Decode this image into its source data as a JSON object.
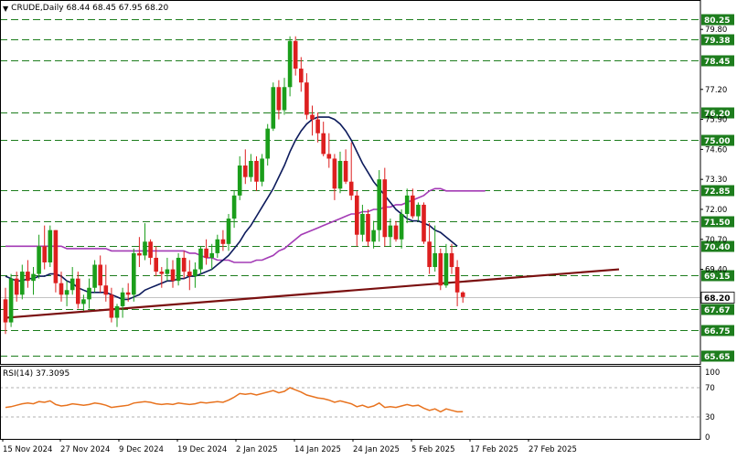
{
  "header": {
    "symbol": "CRUDE,Daily",
    "ohlc": "68.44 68.45 67.95 68.20",
    "dropdown_icon": "triangle-down-icon"
  },
  "rsi_header": {
    "label": "RSI(14) 37.3095"
  },
  "colors": {
    "bull": "#1b9e1b",
    "bear": "#dd1f1f",
    "ma_fast": "#0d1b5c",
    "ma_slow": "#a33bb5",
    "trendline": "#7a1010",
    "rsi": "#e8731f",
    "level_line": "#1d7d1d"
  },
  "chart_data": [
    {
      "type": "candlestick",
      "title": "CRUDE,Daily",
      "ylim": [
        65.3,
        80.6
      ],
      "y_ticks": [
        "79.80",
        "78.45",
        "77.20",
        "76.20",
        "75.90",
        "75.00",
        "74.60",
        "73.30",
        "72.85",
        "72.00",
        "71.50",
        "70.70",
        "70.40",
        "69.40",
        "69.15",
        "68.20",
        "67.67",
        "66.75",
        "65.65"
      ],
      "level_labels": [
        "80.25",
        "79.38",
        "78.45",
        "76.20",
        "75.00",
        "72.85",
        "71.50",
        "70.40",
        "69.15",
        "67.67",
        "66.75",
        "65.65"
      ],
      "current_price": "68.20",
      "x_labels": [
        "15 Nov 2024",
        "27 Nov 2024",
        "9 Dec 2024",
        "19 Dec 2024",
        "2 Jan 2025",
        "14 Jan 2025",
        "24 Jan 2025",
        "5 Feb 2025",
        "17 Feb 2025",
        "27 Feb 2025"
      ],
      "candles": [
        [
          68.1,
          68.6,
          66.6,
          67.1
        ],
        [
          67.1,
          69.2,
          66.9,
          69.0
        ],
        [
          69.0,
          69.3,
          68.0,
          68.3
        ],
        [
          68.3,
          69.6,
          68.1,
          69.3
        ],
        [
          69.3,
          69.8,
          68.6,
          68.9
        ],
        [
          68.9,
          69.5,
          68.3,
          69.2
        ],
        [
          69.2,
          70.9,
          69.0,
          70.4
        ],
        [
          70.4,
          71.3,
          69.4,
          69.7
        ],
        [
          69.7,
          71.3,
          69.5,
          71.1
        ],
        [
          71.1,
          71.1,
          68.4,
          68.8
        ],
        [
          68.8,
          69.3,
          68.0,
          68.3
        ],
        [
          68.3,
          68.9,
          67.8,
          68.5
        ],
        [
          68.5,
          69.5,
          68.3,
          69.0
        ],
        [
          69.0,
          69.3,
          67.7,
          67.9
        ],
        [
          67.9,
          68.3,
          67.6,
          68.1
        ],
        [
          68.1,
          69.0,
          67.7,
          68.6
        ],
        [
          68.6,
          69.8,
          68.4,
          69.6
        ],
        [
          69.6,
          70.0,
          68.4,
          68.7
        ],
        [
          68.7,
          69.6,
          68.0,
          68.3
        ],
        [
          68.3,
          68.6,
          67.1,
          67.3
        ],
        [
          67.3,
          67.9,
          66.9,
          67.8
        ],
        [
          67.8,
          68.6,
          67.3,
          68.4
        ],
        [
          68.4,
          68.8,
          68.0,
          68.3
        ],
        [
          68.3,
          70.3,
          68.0,
          70.1
        ],
        [
          70.1,
          70.8,
          69.5,
          70.0
        ],
        [
          70.0,
          71.4,
          69.8,
          70.6
        ],
        [
          70.6,
          70.7,
          69.6,
          69.9
        ],
        [
          69.9,
          70.4,
          69.1,
          69.3
        ],
        [
          69.3,
          69.5,
          68.6,
          69.2
        ],
        [
          69.2,
          69.9,
          68.9,
          69.4
        ],
        [
          69.4,
          69.8,
          68.6,
          68.9
        ],
        [
          68.9,
          70.1,
          68.7,
          69.9
        ],
        [
          69.9,
          70.2,
          69.0,
          69.3
        ],
        [
          69.3,
          69.8,
          68.5,
          69.1
        ],
        [
          69.1,
          69.7,
          68.6,
          69.4
        ],
        [
          69.4,
          70.4,
          69.2,
          70.3
        ],
        [
          70.3,
          70.7,
          69.6,
          69.9
        ],
        [
          69.9,
          70.5,
          69.4,
          70.1
        ],
        [
          70.1,
          70.9,
          69.9,
          70.7
        ],
        [
          70.7,
          71.1,
          70.2,
          70.5
        ],
        [
          70.5,
          71.8,
          70.2,
          71.6
        ],
        [
          71.6,
          72.8,
          71.2,
          72.6
        ],
        [
          72.6,
          74.3,
          72.4,
          73.9
        ],
        [
          73.9,
          74.6,
          73.1,
          73.4
        ],
        [
          73.4,
          74.4,
          73.2,
          74.1
        ],
        [
          74.1,
          74.3,
          72.8,
          73.2
        ],
        [
          73.2,
          74.4,
          73.0,
          74.2
        ],
        [
          74.2,
          75.7,
          73.9,
          75.5
        ],
        [
          75.5,
          77.5,
          75.4,
          77.3
        ],
        [
          77.3,
          77.6,
          75.9,
          76.3
        ],
        [
          76.3,
          77.7,
          76.1,
          77.3
        ],
        [
          77.3,
          79.5,
          76.9,
          79.3
        ],
        [
          79.3,
          79.5,
          77.8,
          78.1
        ],
        [
          78.1,
          78.6,
          77.1,
          77.5
        ],
        [
          77.5,
          77.9,
          75.9,
          76.1
        ],
        [
          76.1,
          76.5,
          75.2,
          75.9
        ],
        [
          75.9,
          76.2,
          74.9,
          75.3
        ],
        [
          75.3,
          75.8,
          74.3,
          74.4
        ],
        [
          74.4,
          75.3,
          73.8,
          74.2
        ],
        [
          74.2,
          74.4,
          72.4,
          72.9
        ],
        [
          72.9,
          74.5,
          72.7,
          74.1
        ],
        [
          74.1,
          74.6,
          73.1,
          73.2
        ],
        [
          73.2,
          74.9,
          72.4,
          72.6
        ],
        [
          72.6,
          72.8,
          70.4,
          70.9
        ],
        [
          70.9,
          72.2,
          70.6,
          71.8
        ],
        [
          71.8,
          72.0,
          70.4,
          70.6
        ],
        [
          70.6,
          71.5,
          70.3,
          71.1
        ],
        [
          71.1,
          73.7,
          70.6,
          73.3
        ],
        [
          73.3,
          73.8,
          70.4,
          70.8
        ],
        [
          70.8,
          71.6,
          70.4,
          71.3
        ],
        [
          71.3,
          71.5,
          70.6,
          70.7
        ],
        [
          70.7,
          72.0,
          70.3,
          71.8
        ],
        [
          71.8,
          72.9,
          71.4,
          72.6
        ],
        [
          72.6,
          72.9,
          71.6,
          71.7
        ],
        [
          71.7,
          72.3,
          71.5,
          72.2
        ],
        [
          72.2,
          72.3,
          70.5,
          70.6
        ],
        [
          70.6,
          71.4,
          69.2,
          69.5
        ],
        [
          69.5,
          71.3,
          69.3,
          70.1
        ],
        [
          70.1,
          70.3,
          68.5,
          68.7
        ],
        [
          68.7,
          70.5,
          68.6,
          70.1
        ],
        [
          70.1,
          70.5,
          69.2,
          69.5
        ],
        [
          69.5,
          69.8,
          67.8,
          68.4
        ],
        [
          68.4,
          68.45,
          67.95,
          68.2
        ]
      ],
      "series": [
        {
          "type": "line",
          "values": [
            69.1,
            69.0,
            68.9,
            68.9,
            69.0,
            69.0,
            69.1,
            69.1,
            69.2,
            69.2,
            69.1,
            68.9,
            68.8,
            68.6,
            68.5,
            68.4,
            68.4,
            68.4,
            68.4,
            68.3,
            68.2,
            68.1,
            68.1,
            68.2,
            68.3,
            68.5,
            68.6,
            68.7,
            68.8,
            68.9,
            68.9,
            69.0,
            69.0,
            69.1,
            69.1,
            69.2,
            69.3,
            69.4,
            69.6,
            69.8,
            70.0,
            70.3,
            70.6,
            71.0,
            71.3,
            71.7,
            72.1,
            72.5,
            72.9,
            73.4,
            73.9,
            74.5,
            75.0,
            75.4,
            75.7,
            75.9,
            76.0,
            76.0,
            76.0,
            75.9,
            75.7,
            75.4,
            75.0,
            74.5,
            74.0,
            73.6,
            73.2,
            72.9,
            72.6,
            72.3,
            72.0,
            71.8,
            71.6,
            71.5,
            71.5,
            71.4,
            71.3,
            71.1,
            71.0,
            70.8,
            70.6,
            70.4
          ]
        },
        {
          "type": "line",
          "values": [
            70.4,
            70.4,
            70.4,
            70.4,
            70.4,
            70.4,
            70.4,
            70.4,
            70.4,
            70.4,
            70.4,
            70.3,
            70.3,
            70.3,
            70.3,
            70.3,
            70.3,
            70.3,
            70.3,
            70.2,
            70.2,
            70.2,
            70.2,
            70.2,
            70.2,
            70.2,
            70.2,
            70.2,
            70.2,
            70.2,
            70.2,
            70.2,
            70.2,
            70.1,
            70.1,
            70.0,
            69.9,
            69.9,
            69.8,
            69.8,
            69.8,
            69.7,
            69.7,
            69.7,
            69.7,
            69.8,
            69.8,
            69.9,
            70.0,
            70.2,
            70.3,
            70.5,
            70.7,
            70.9,
            71.0,
            71.1,
            71.2,
            71.3,
            71.4,
            71.5,
            71.6,
            71.7,
            71.8,
            71.8,
            71.9,
            71.9,
            72.0,
            72.0,
            72.1,
            72.1,
            72.2,
            72.2,
            72.3,
            72.4,
            72.5,
            72.6,
            72.8,
            72.9,
            72.9,
            72.8,
            72.8,
            72.8,
            72.8,
            72.8,
            72.8,
            72.8,
            72.8
          ]
        }
      ],
      "trendline": {
        "start": [
          0,
          67.3
        ],
        "end": [
          110,
          69.4
        ]
      }
    },
    {
      "type": "line",
      "title": "RSI(14) 37.3095",
      "ylim": [
        0,
        100
      ],
      "y_ticks": [
        "100",
        "70",
        "30",
        "0"
      ],
      "values": [
        43,
        44,
        46,
        48,
        49,
        48,
        51,
        50,
        52,
        47,
        45,
        46,
        48,
        47,
        46,
        47,
        49,
        48,
        46,
        43,
        44,
        45,
        46,
        49,
        50,
        51,
        50,
        48,
        47,
        48,
        47,
        49,
        48,
        47,
        48,
        50,
        49,
        50,
        51,
        50,
        53,
        57,
        62,
        61,
        62,
        60,
        62,
        64,
        66,
        63,
        65,
        70,
        67,
        64,
        60,
        58,
        56,
        55,
        53,
        50,
        52,
        50,
        48,
        44,
        46,
        43,
        45,
        49,
        43,
        44,
        43,
        45,
        47,
        45,
        46,
        42,
        39,
        41,
        37,
        41,
        39,
        37,
        37.3
      ]
    }
  ]
}
